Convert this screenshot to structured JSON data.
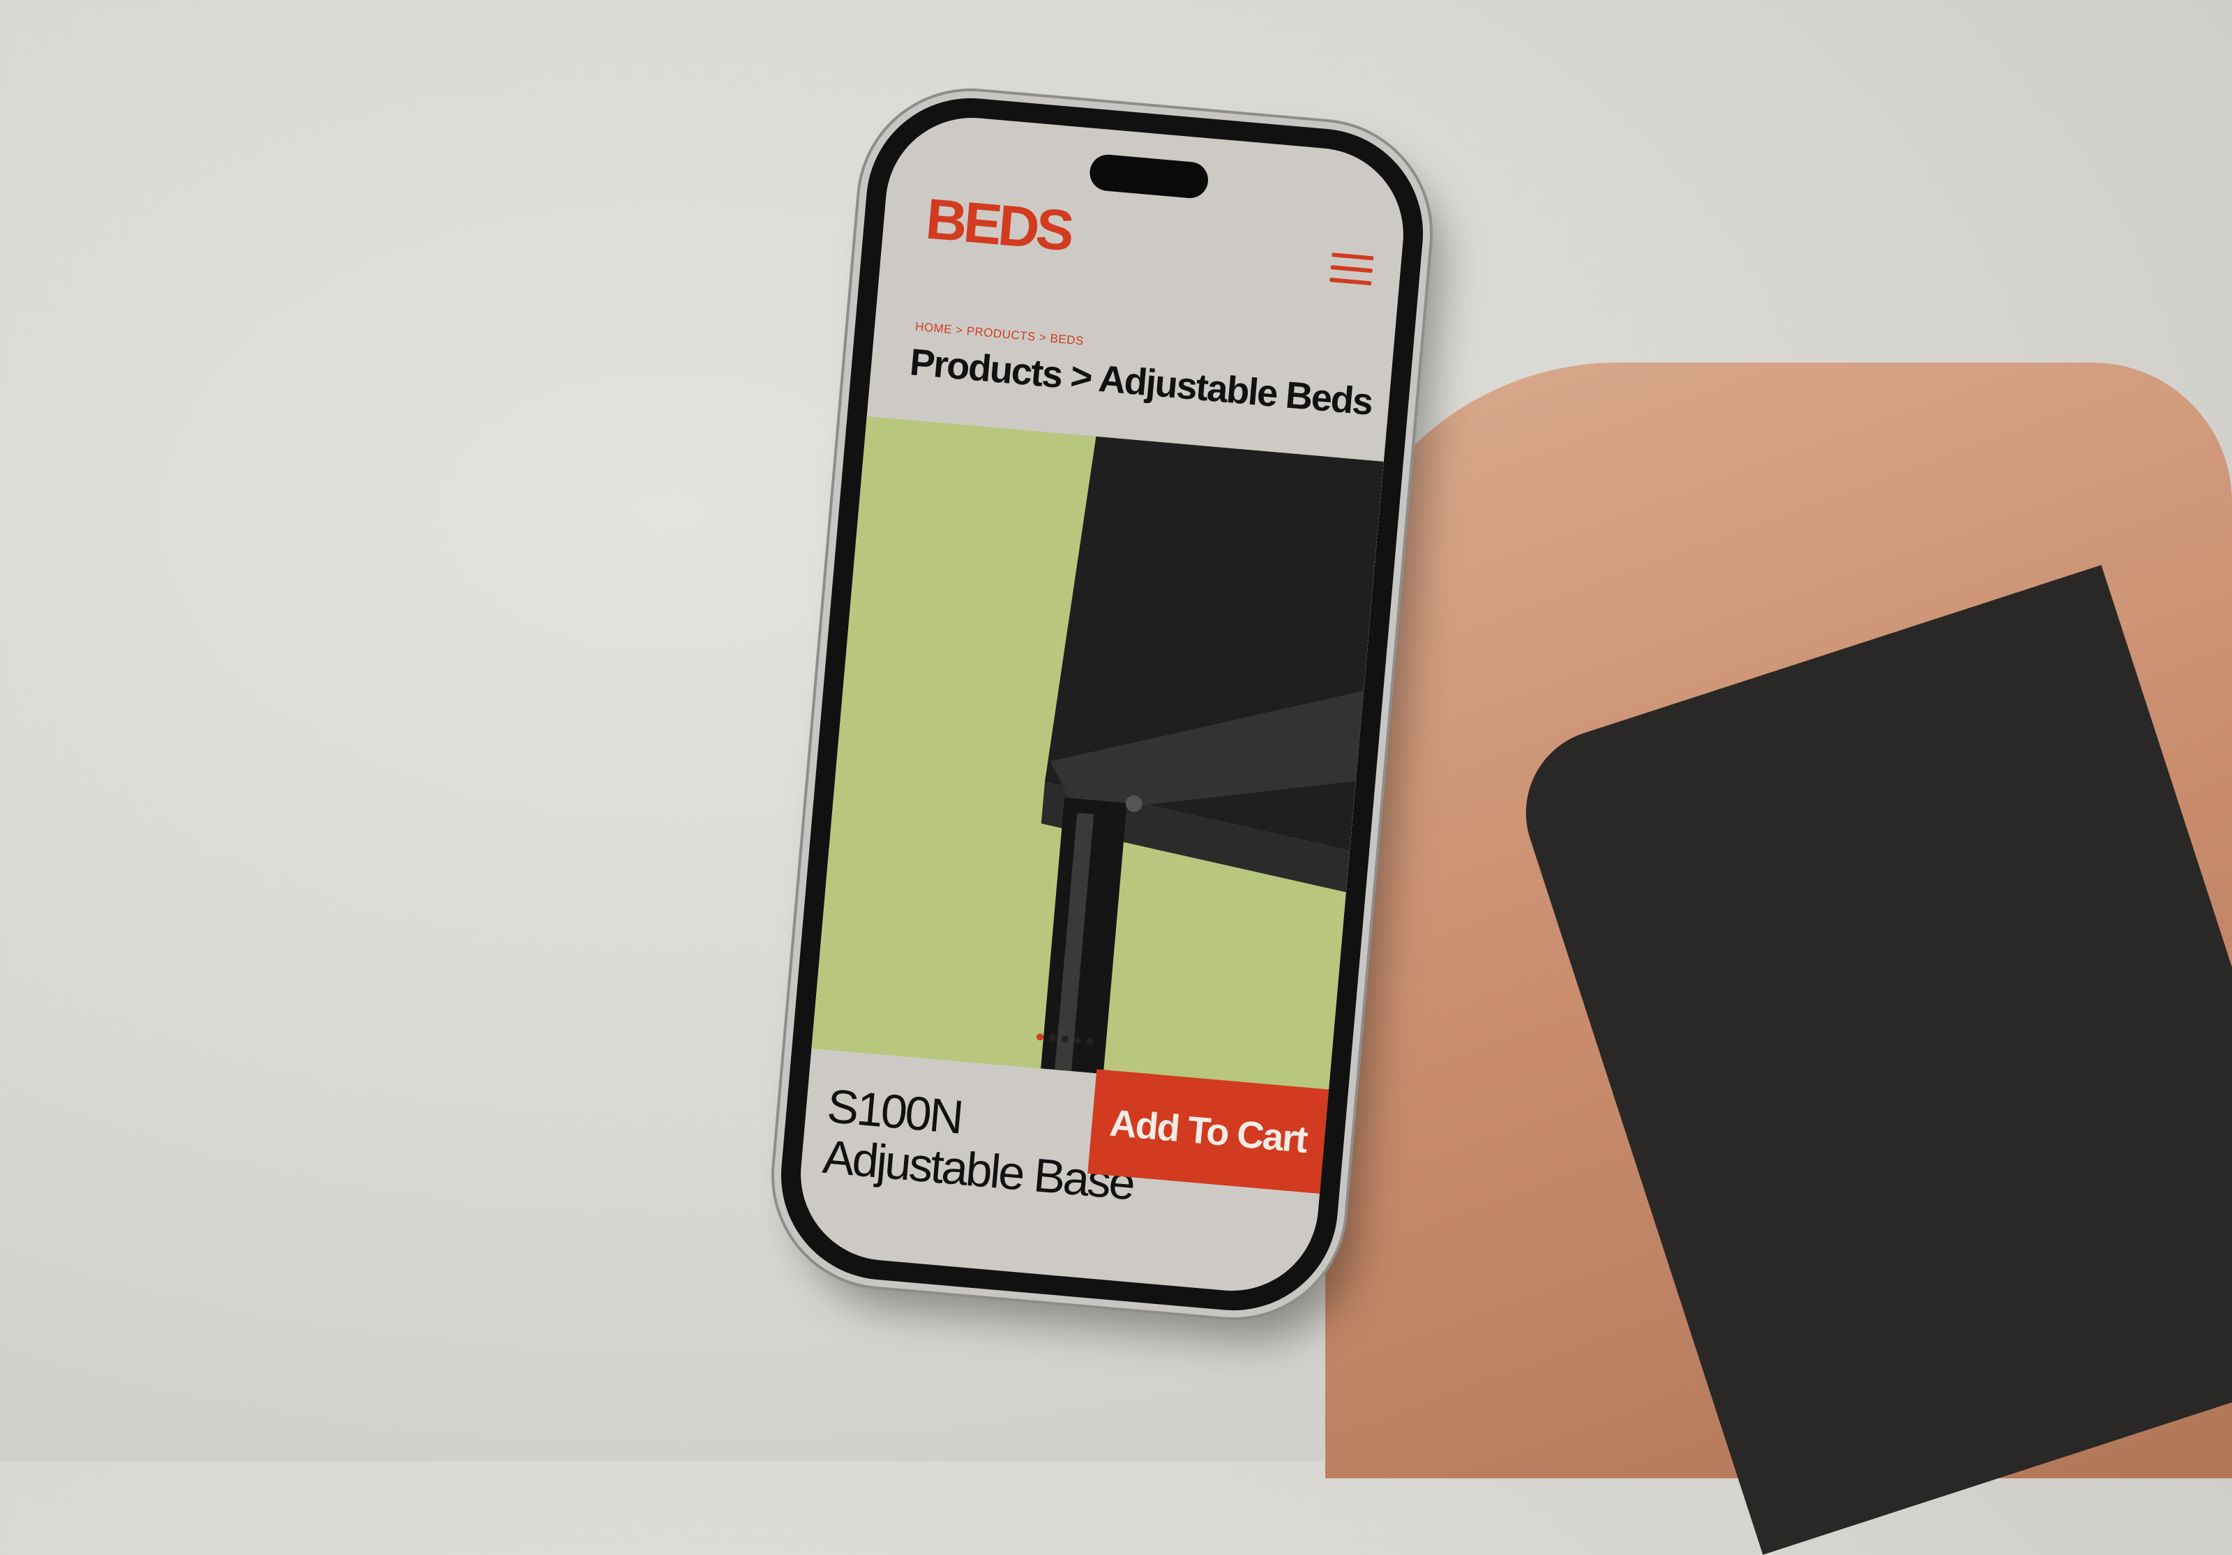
{
  "app": {
    "brand": "BEDS",
    "breadcrumb": "HOME > PRODUCTS > BEDS",
    "page_title": "Products > Adjustable Beds"
  },
  "carousel": {
    "slide_count": 5,
    "active_index": 0
  },
  "product": {
    "name_line1": "S100N",
    "name_line2": "Adjustable Base"
  },
  "actions": {
    "add_to_cart_label": "Add To Cart"
  },
  "colors": {
    "brand_red": "#d23b1f",
    "screen_bg": "#cdcac6",
    "hero_green": "#b8c77d",
    "text_dark": "#111111"
  },
  "icons": {
    "menu": "hamburger-menu-icon"
  }
}
